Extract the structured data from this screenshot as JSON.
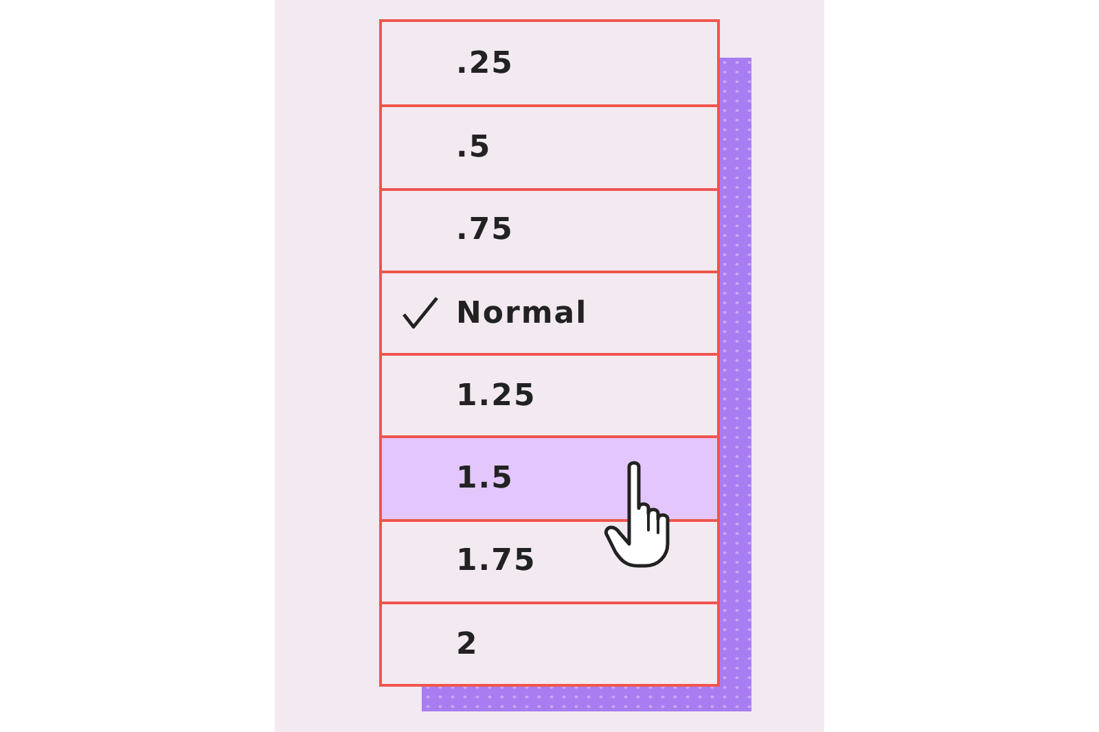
{
  "menu": {
    "items": [
      {
        "label": ".25",
        "checked": false,
        "selected": false
      },
      {
        "label": ".5",
        "checked": false,
        "selected": false
      },
      {
        "label": ".75",
        "checked": false,
        "selected": false
      },
      {
        "label": "Normal",
        "checked": true,
        "selected": false
      },
      {
        "label": "1.25",
        "checked": false,
        "selected": false
      },
      {
        "label": "1.5",
        "checked": false,
        "selected": true
      },
      {
        "label": "1.75",
        "checked": false,
        "selected": false
      },
      {
        "label": "2",
        "checked": false,
        "selected": false
      }
    ]
  }
}
